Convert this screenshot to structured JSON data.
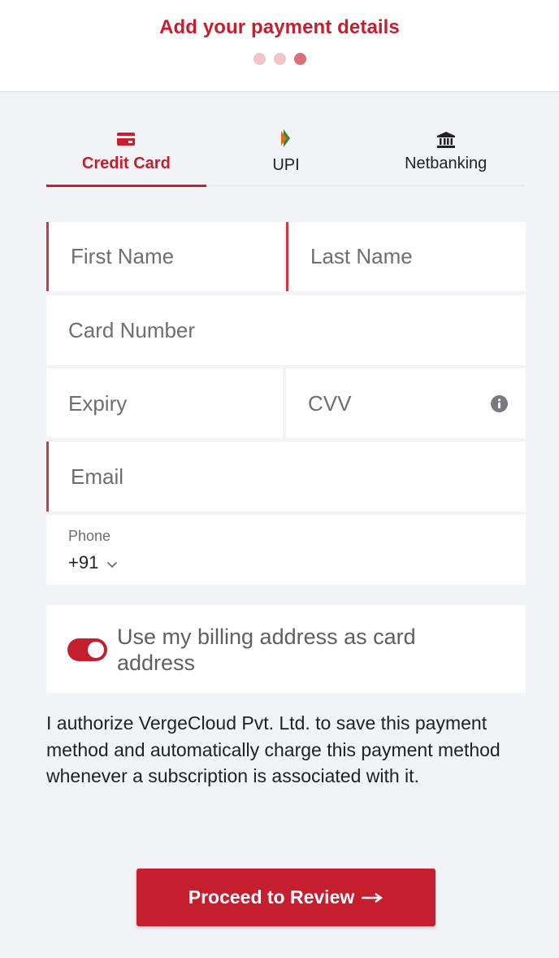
{
  "header": {
    "title": "Add your payment details",
    "steps": 3,
    "active_step": 3
  },
  "tabs": [
    {
      "label": "Credit Card",
      "icon": "credit-card-icon",
      "active": true
    },
    {
      "label": "UPI",
      "icon": "upi-icon",
      "active": false
    },
    {
      "label": "Netbanking",
      "icon": "bank-icon",
      "active": false
    }
  ],
  "form": {
    "first_name_placeholder": "First Name",
    "last_name_placeholder": "Last Name",
    "card_number_placeholder": "Card Number",
    "expiry_placeholder": "Expiry",
    "cvv_placeholder": "CVV",
    "email_placeholder": "Email",
    "phone_label": "Phone",
    "phone_code": "+91"
  },
  "billing": {
    "label": "Use my billing address as card address",
    "enabled": true
  },
  "authorization_text": "I authorize VergeCloud Pvt. Ltd. to save this payment method and automatically charge this payment method whenever a subscription is associated with it.",
  "proceed_button": "Proceed to Review",
  "colors": {
    "accent": "#c41e2f",
    "error_border": "#d13745",
    "background": "#f2f3f7"
  }
}
